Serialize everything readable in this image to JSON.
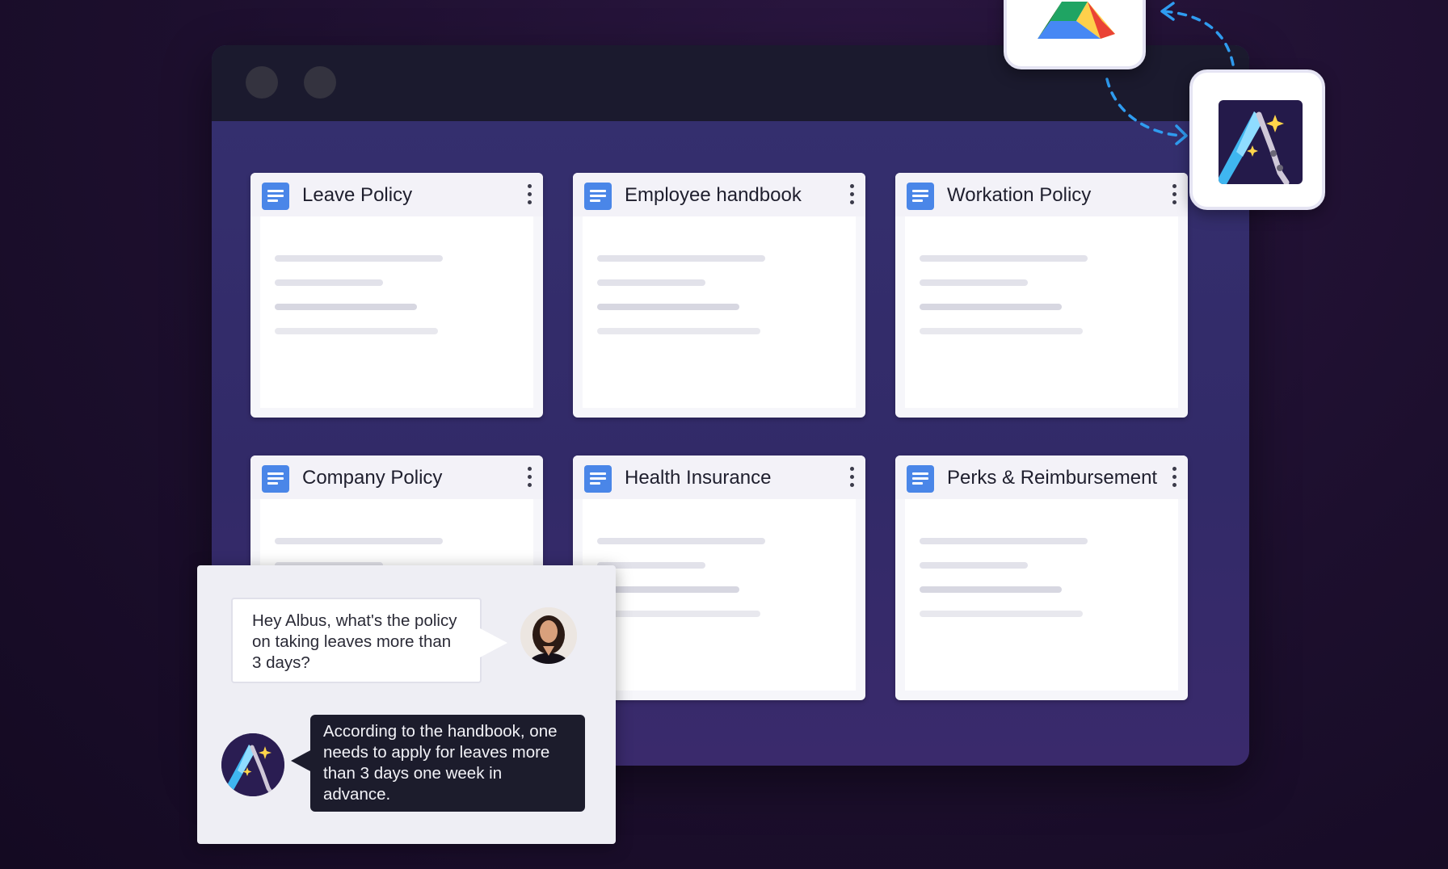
{
  "documents": {
    "row1": [
      {
        "title": "Leave Policy"
      },
      {
        "title": "Employee handbook"
      },
      {
        "title": "Workation Policy"
      }
    ],
    "row2": [
      {
        "title": "Company Policy"
      },
      {
        "title": "Health Insurance"
      },
      {
        "title": "Perks & Reimbursement"
      }
    ]
  },
  "icons": {
    "doc": "google-docs-icon",
    "menu": "kebab-menu-icon",
    "drive": "google-drive-icon",
    "albus": "albus-logo-icon",
    "sync": "dashed-arrow-icon"
  },
  "chat": {
    "user_message": "Hey Albus, what's the policy on taking leaves more than 3 days?",
    "bot_reply": "According to the handbook, one needs to apply for leaves more than 3 days one week in advance."
  },
  "colors": {
    "background": "#1d0f2e",
    "window": "#35306f",
    "doc_blue": "#4a86e8",
    "arrow": "#2f9cf0",
    "bot_bubble": "#1c1c2c"
  }
}
